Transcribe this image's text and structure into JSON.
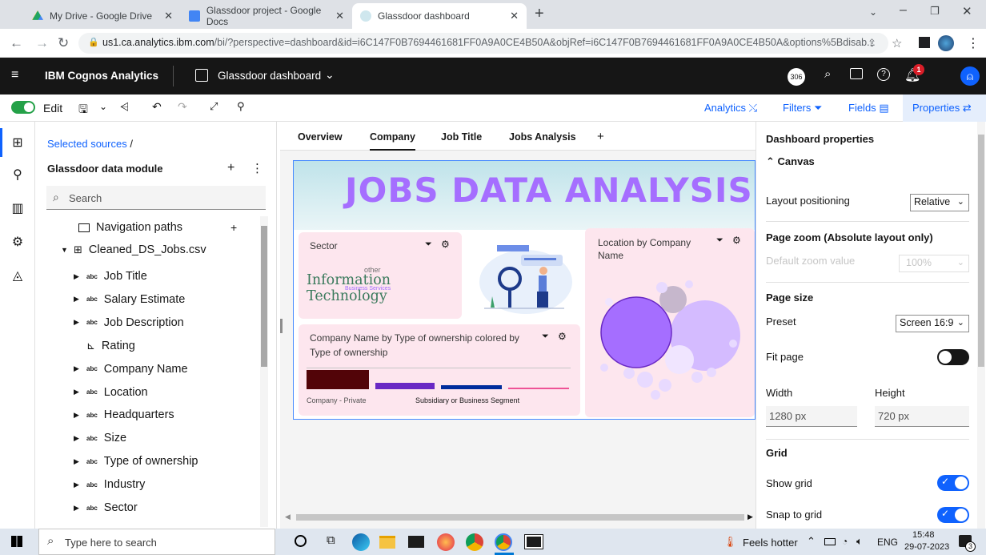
{
  "browser": {
    "tabs": [
      {
        "title": "My Drive - Google Drive",
        "icon_color": "#1fa463"
      },
      {
        "title": "Glassdoor project - Google Docs",
        "icon_color": "#4285f4"
      },
      {
        "title": "Glassdoor dashboard",
        "icon_color": "#cfe7ee"
      }
    ],
    "url_host": "us1.ca.analytics.ibm.com",
    "url_path": "/bi/?perspective=dashboard&id=i6C147F0B7694461681FF0A9A0CE4B50A&objRef=i6C147F0B7694461681FF0A9A0CE4B50A&options%5Bdisab..."
  },
  "header": {
    "product": "IBM Cognos Analytics",
    "dashboard_title": "Glassdoor dashboard",
    "trial_badge": "306",
    "notif_count": "1"
  },
  "toolbar": {
    "edit_label": "Edit",
    "analytics_label": "Analytics",
    "filters_label": "Filters",
    "fields_label": "Fields",
    "properties_label": "Properties"
  },
  "sources": {
    "breadcrumb": "Selected sources",
    "module_title": "Glassdoor data module",
    "search_placeholder": "Search",
    "nav_paths": "Navigation paths",
    "csv_name": "Cleaned_DS_Jobs.csv",
    "fields": [
      {
        "label": "Job Title",
        "type": "abc"
      },
      {
        "label": "Salary Estimate",
        "type": "abc"
      },
      {
        "label": "Job Description",
        "type": "abc"
      },
      {
        "label": "Rating",
        "type": "measure"
      },
      {
        "label": "Company Name",
        "type": "abc"
      },
      {
        "label": "Location",
        "type": "abc"
      },
      {
        "label": "Headquarters",
        "type": "abc"
      },
      {
        "label": "Size",
        "type": "abc"
      },
      {
        "label": "Type of ownership",
        "type": "abc"
      },
      {
        "label": "Industry",
        "type": "abc"
      },
      {
        "label": "Sector",
        "type": "abc"
      }
    ]
  },
  "canvas": {
    "tabs": [
      "Overview",
      "Company",
      "Job Title",
      "Jobs Analysis"
    ],
    "active_tab": "Company",
    "banner_title": "JOBS DATA ANALYSIS",
    "sector_card": {
      "title": "Sector",
      "main_word": "Information Technology",
      "small_word_1": "other",
      "small_word_2": "Business Services"
    },
    "location_card": {
      "title": "Location by Company Name"
    },
    "ownership_card": {
      "title": "Company Name by Type of ownership colored by Type of ownership",
      "label_left": "Company - Private",
      "label_right": "Subsidiary or Business Segment"
    }
  },
  "properties": {
    "title": "Dashboard properties",
    "section_canvas": "Canvas",
    "layout_positioning_label": "Layout positioning",
    "layout_positioning_value": "Relative",
    "page_zoom_head": "Page zoom (Absolute layout only)",
    "default_zoom_label": "Default zoom value",
    "default_zoom_value": "100%",
    "page_size_head": "Page size",
    "preset_label": "Preset",
    "preset_value": "Screen 16:9",
    "fit_page_label": "Fit page",
    "width_label": "Width",
    "width_value": "1280 px",
    "height_label": "Height",
    "height_value": "720 px",
    "grid_head": "Grid",
    "show_grid_label": "Show grid",
    "snap_grid_label": "Snap to grid"
  },
  "taskbar": {
    "search_placeholder": "Type here to search",
    "weather": "Feels hotter",
    "lang": "ENG",
    "time": "15:48",
    "date": "29-07-2023",
    "notif": "3"
  },
  "colors": {
    "cognos_header": "#161616",
    "accent_blue": "#0f62fe",
    "toggle_on": "#0f62fe",
    "banner_text": "#a56eff",
    "card_bg": "#fde6ee"
  }
}
